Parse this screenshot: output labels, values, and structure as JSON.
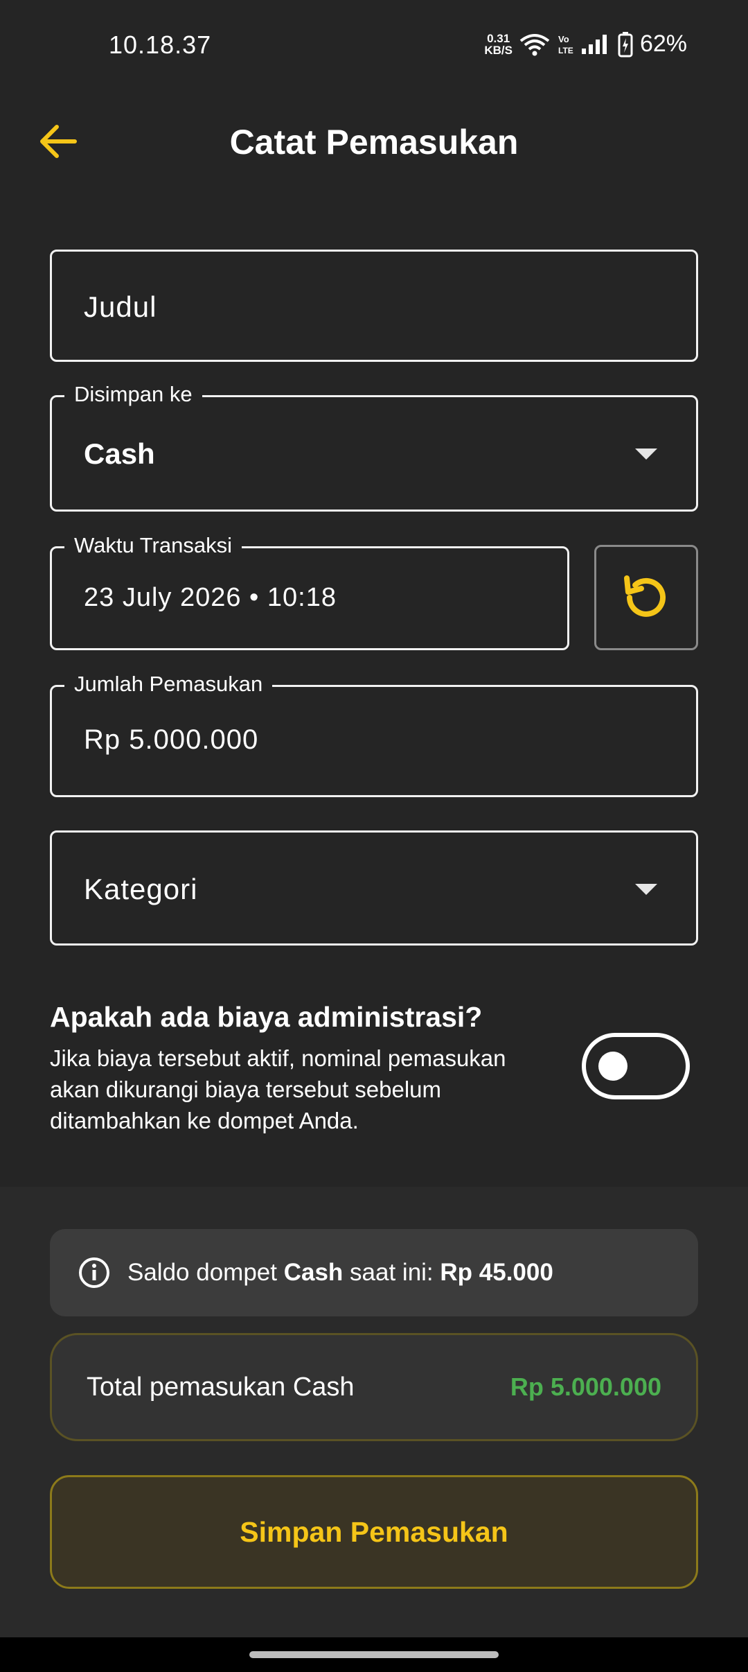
{
  "status_bar": {
    "time": "10.18.37",
    "net_speed_value": "0.31",
    "net_speed_unit": "KB/S",
    "battery_percent": "62%"
  },
  "header": {
    "title": "Catat Pemasukan"
  },
  "form": {
    "title_placeholder": "Judul",
    "wallet_label": "Disimpan ke",
    "wallet_value": "Cash",
    "time_label": "Waktu Transaksi",
    "time_value": "23 July 2026 • 10:18",
    "amount_label": "Jumlah Pemasukan",
    "amount_value": "Rp 5.000.000",
    "category_placeholder": "Kategori"
  },
  "admin_fee": {
    "question": "Apakah ada biaya administrasi?",
    "description": "Jika biaya tersebut aktif, nominal pemasukan akan dikurangi biaya tersebut sebelum ditambahkan ke dompet Anda.",
    "enabled": false
  },
  "summary": {
    "info_prefix": "Saldo dompet ",
    "info_wallet": "Cash",
    "info_middle": " saat ini: ",
    "info_balance": "Rp 45.000",
    "total_label": "Total pemasukan Cash",
    "total_value": "Rp 5.000.000"
  },
  "actions": {
    "save_label": "Simpan Pemasukan"
  },
  "colors": {
    "accent": "#f5c518",
    "positive": "#4caf50",
    "background": "#252525"
  }
}
